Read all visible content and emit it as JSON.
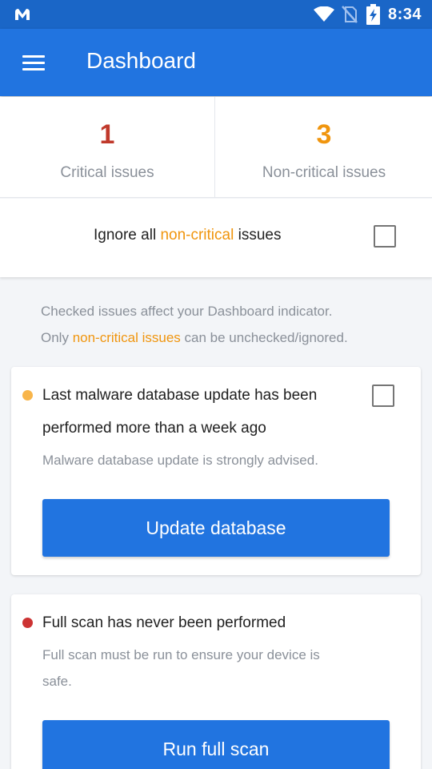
{
  "status_bar": {
    "time": "8:34",
    "icons": [
      "malwarebytes-logo-icon",
      "wifi-icon",
      "no-sim-icon",
      "battery-charging-icon"
    ]
  },
  "app_bar": {
    "menu_icon": "hamburger-menu-icon",
    "title": "Dashboard"
  },
  "summary": {
    "critical": {
      "count": "1",
      "label": "Critical issues",
      "color": "#c0392b"
    },
    "non_critical": {
      "count": "3",
      "label": "Non-critical issues",
      "color": "#f0950e"
    }
  },
  "ignore": {
    "prefix": "Ignore all ",
    "highlight": "non-critical",
    "suffix": " issues",
    "checked": false
  },
  "info": {
    "line1": "Checked issues affect your Dashboard indicator.",
    "line2_prefix": "Only ",
    "line2_highlight": "non-critical issues",
    "line2_suffix": " can be unchecked/ignored."
  },
  "issues": [
    {
      "severity": "non-critical",
      "dot_color": "#f8b54a",
      "title_line1": "Last malware database update has been",
      "title_line2": "performed more than a week ago",
      "description": "Malware database update is strongly advised.",
      "button": "Update database",
      "checked": false
    },
    {
      "severity": "critical",
      "dot_color": "#cc3333",
      "title_line1": "Full scan has never been performed",
      "description_line1": "Full scan must be run to ensure your device is",
      "description_line2": "safe.",
      "button": "Run full scan"
    }
  ],
  "colors": {
    "status_bar": "#1a66c7",
    "app_bar": "#2174e0",
    "accent_orange": "#f0950e",
    "critical_red": "#c0392b",
    "button_blue": "#2174e0"
  }
}
